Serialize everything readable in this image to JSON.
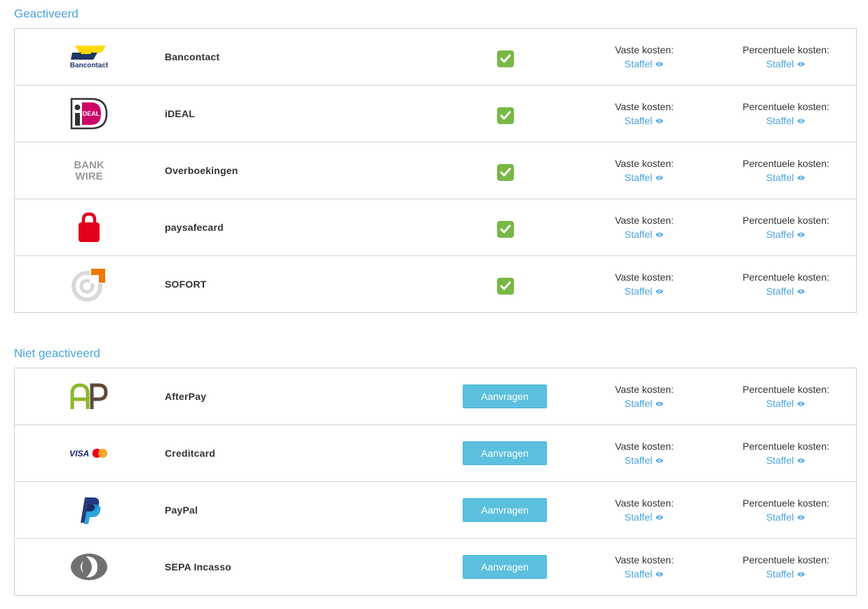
{
  "colors": {
    "accent": "#4ba3dc",
    "check": "#78b843",
    "button": "#5bc0de"
  },
  "activated": {
    "title": "Geactiveerd",
    "methods": [
      {
        "name": "Bancontact",
        "logo": "bancontact-logo",
        "logo_text": "Bancontact",
        "fixed_label": "Vaste kosten:",
        "fixed_link": "Staffel",
        "percent_label": "Percentuele kosten:",
        "percent_link": "Staffel"
      },
      {
        "name": "iDEAL",
        "logo": "ideal-logo",
        "logo_text": "iDEAL",
        "fixed_label": "Vaste kosten:",
        "fixed_link": "Staffel",
        "percent_label": "Percentuele kosten:",
        "percent_link": "Staffel"
      },
      {
        "name": "Overboekingen",
        "logo": "bankwire-logo",
        "logo_text": "BANK WIRE",
        "fixed_label": "Vaste kosten:",
        "fixed_link": "Staffel",
        "percent_label": "Percentuele kosten:",
        "percent_link": "Staffel"
      },
      {
        "name": "paysafecard",
        "logo": "paysafecard-logo",
        "logo_text": "",
        "fixed_label": "Vaste kosten:",
        "fixed_link": "Staffel",
        "percent_label": "Percentuele kosten:",
        "percent_link": "Staffel"
      },
      {
        "name": "SOFORT",
        "logo": "sofort-logo",
        "logo_text": "",
        "fixed_label": "Vaste kosten:",
        "fixed_link": "Staffel",
        "percent_label": "Percentuele kosten:",
        "percent_link": "Staffel"
      }
    ]
  },
  "not_activated": {
    "title": "Niet geactiveerd",
    "button_label": "Aanvragen",
    "methods": [
      {
        "name": "AfterPay",
        "logo": "afterpay-logo",
        "logo_text": "AP",
        "fixed_label": "Vaste kosten:",
        "fixed_link": "Staffel",
        "percent_label": "Percentuele kosten:",
        "percent_link": "Staffel"
      },
      {
        "name": "Creditcard",
        "logo": "visa-mastercard-logo",
        "logo_text": "VISA",
        "fixed_label": "Vaste kosten:",
        "fixed_link": "Staffel",
        "percent_label": "Percentuele kosten:",
        "percent_link": "Staffel"
      },
      {
        "name": "PayPal",
        "logo": "paypal-logo",
        "logo_text": "",
        "fixed_label": "Vaste kosten:",
        "fixed_link": "Staffel",
        "percent_label": "Percentuele kosten:",
        "percent_link": "Staffel"
      },
      {
        "name": "SEPA Incasso",
        "logo": "sepa-logo",
        "logo_text": "",
        "fixed_label": "Vaste kosten:",
        "fixed_link": "Staffel",
        "percent_label": "Percentuele kosten:",
        "percent_link": "Staffel"
      }
    ]
  }
}
